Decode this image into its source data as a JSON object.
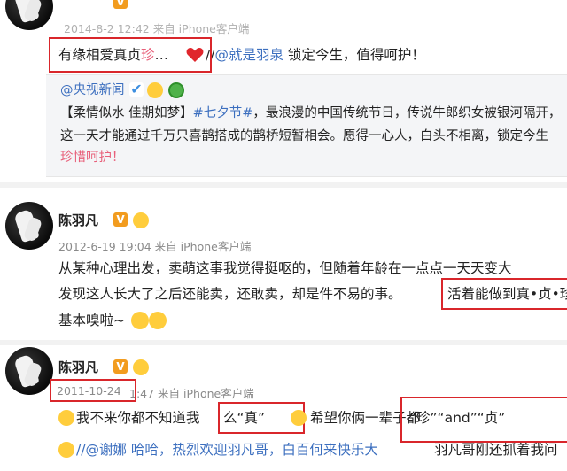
{
  "post1": {
    "meta": "2014-8-2 12:42 来自 iPhone客户端",
    "text_a": "有缘相爱真贞",
    "text_b": "…",
    "text_c": " //",
    "mention": "@就是羽泉",
    "text_d": " 锁定今生，值得呵护！",
    "quote": {
      "author": "@央视新闻",
      "line1": "【柔情似水 佳期如梦】",
      "hashtag": "#七夕节#",
      "line1_rest": "，最浪漫的中国传统节日，传说牛郎织女被银河隔开，",
      "line2": "这一天才能通过千万只喜鹊搭成的鹊桥短暂相会。愿得一心人，白头不相离，锁定今生",
      "line3": "珍惜呵护！"
    }
  },
  "post2": {
    "name": "陈羽凡",
    "meta": "2012-6-19 19:04 来自 iPhone客户端",
    "line1": "从某种心理出发，卖萌这事我觉得挺呕的，但随着年龄在一点点一天天变大",
    "line2a": "发现这人长大了之后还能卖，还敢卖，却是件不易的事。",
    "line2b": "活着能做到真•贞•珍",
    "line3": "基本嗅啦~"
  },
  "post3": {
    "name": "陈羽凡",
    "date": "2011-10-24",
    "meta_rest": " 1",
    "meta_tail": "47 来自 iPhone客户端",
    "line1a": "我不来你都不知道我",
    "line1b": "么“真”",
    "line1c": "希望你俩一辈子都",
    "line1d": "“珍”“and”“贞”",
    "line2": "//@谢娜 哈哈，热烈欢迎羽凡哥，白百何来快乐大",
    "line2b": "羽凡哥刚还抓着我问"
  },
  "colors": {
    "highlight": "#d9262b",
    "link": "#3c6fbf",
    "pink": "#e8607a"
  },
  "icons": [
    "vip-badge-icon",
    "verified-icon",
    "emoji-icon",
    "heart-icon"
  ]
}
